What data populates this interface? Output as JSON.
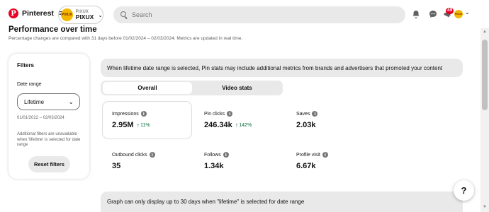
{
  "header": {
    "brand_name": "Pinterest",
    "brand_logo_glyph": "P",
    "menu_icon": "≡",
    "account": {
      "avatar_text": "PIXUX",
      "small_label": "PIXUX",
      "name": "PIXUX",
      "chevron": "⌄"
    },
    "search_placeholder": "Search",
    "notifications_badge": "49",
    "profile_avatar_text": "PIXUX",
    "profile_chevron": "⌄"
  },
  "section": {
    "title": "Performance over time",
    "subtitle": "Percentage changes are compared with 31 days before 01/02/2024 – 02/03/2024. Metrics are updated in real time."
  },
  "filters": {
    "title": "Filters",
    "date_range_label": "Date range",
    "date_range_value": "Lifetime",
    "date_range_chevron": "⌄",
    "date_range_text": "01/01/2022 – 02/03/2024",
    "note": "Additional filters are unavailable when 'lifetime' is selected for date range",
    "reset_label": "Reset filters"
  },
  "info_banner": "When lifetime date range is selected, Pin stats may include additional metrics from brands and advertisers that promoted your content",
  "tabs": [
    {
      "label": "Overall",
      "selected": true
    },
    {
      "label": "Video stats",
      "selected": false
    }
  ],
  "metrics": {
    "impressions": {
      "label": "Impressions",
      "value": "2.95M",
      "delta": "11%"
    },
    "pin_clicks": {
      "label": "Pin clicks",
      "value": "246.34k",
      "delta": "142%"
    },
    "saves": {
      "label": "Saves",
      "value": "2.03k"
    },
    "outbound_clicks": {
      "label": "Outbound clicks",
      "value": "35"
    },
    "follows": {
      "label": "Follows",
      "value": "1.34k"
    },
    "profile_visit": {
      "label": "Profile visit",
      "value": "6.67k"
    }
  },
  "graph_banner": "Graph can only display up to 30 days when \"lifetime\" is selected for date range",
  "help_label": "?",
  "colors": {
    "brand": "#e60023",
    "positive_delta": "#0a6b3a",
    "avatar": "#f5b800",
    "surface_gray": "#e9e9e9"
  }
}
